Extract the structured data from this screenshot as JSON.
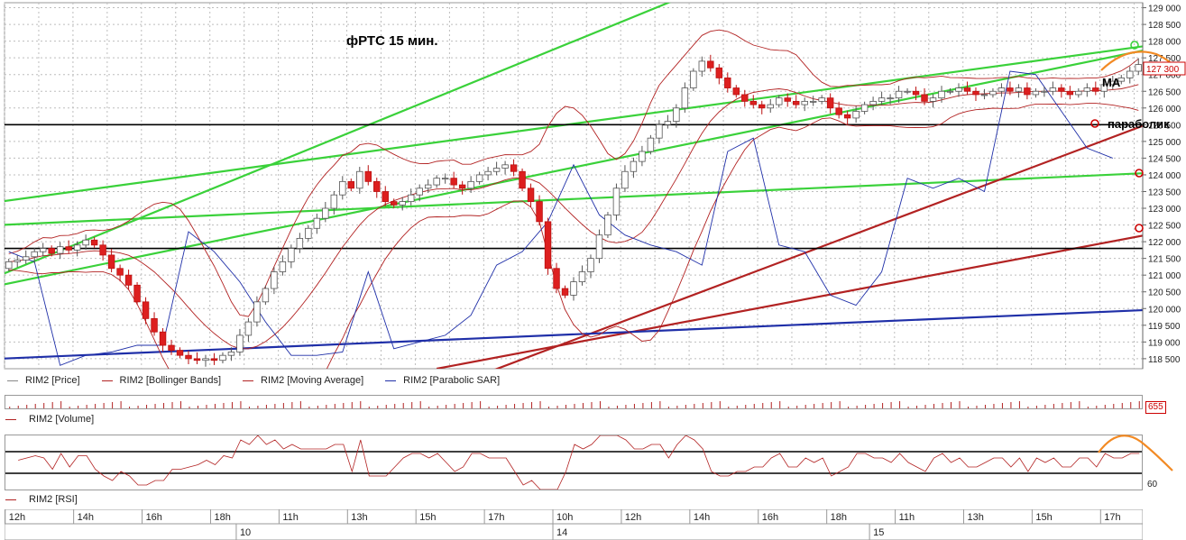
{
  "title": "фРТС   15 мин.",
  "annotations": {
    "ma": "MA",
    "parabolic": "параболик"
  },
  "legend": [
    {
      "label": "RIM2 [Price]",
      "color": "#888888"
    },
    {
      "label": "RIM2 [Bollinger Bands]",
      "color": "#b22222"
    },
    {
      "label": "RIM2 [Moving Average]",
      "color": "#b22222"
    },
    {
      "label": "RIM2 [Parabolic SAR]",
      "color": "#1f2fa8"
    }
  ],
  "volume_label": "RIM2 [Volume]",
  "volume_tag": "655",
  "rsi_label": "RIM2 [RSI]",
  "rsi_tag": "60",
  "price_tag": "127 300",
  "colors": {
    "up_candle": "#ffffff",
    "down_candle": "#dd1f1f",
    "bollinger": "#b22222",
    "sar": "#1f2fa8",
    "trend_green": "#3ad13a",
    "trend_red": "#b22222",
    "trend_blue": "#1f2fa8",
    "forecast": "#f28a24"
  },
  "chart_data": {
    "type": "candlestick",
    "title": "фРТС   15 мин.",
    "y_ticks": [
      "118 500",
      "119 000",
      "119 500",
      "120 000",
      "120 500",
      "121 000",
      "121 500",
      "122 000",
      "122 500",
      "123 000",
      "123 500",
      "124 000",
      "124 500",
      "125 000",
      "125 500",
      "126 000",
      "126 500",
      "127 000",
      "127 500",
      "128 000",
      "128 500",
      "129 000"
    ],
    "ylim": [
      118200,
      129150
    ],
    "x_ticks": [
      {
        "label": "12h",
        "index": 0
      },
      {
        "label": "14h",
        "index": 8
      },
      {
        "label": "16h",
        "index": 16
      },
      {
        "label": "18h",
        "index": 24
      },
      {
        "label": "11h",
        "index": 32
      },
      {
        "label": "13h",
        "index": 40
      },
      {
        "label": "15h",
        "index": 48
      },
      {
        "label": "17h",
        "index": 56
      },
      {
        "label": "10h",
        "index": 64
      },
      {
        "label": "12h",
        "index": 72
      },
      {
        "label": "14h",
        "index": 80
      },
      {
        "label": "16h",
        "index": 88
      },
      {
        "label": "18h",
        "index": 96
      },
      {
        "label": "11h",
        "index": 104
      },
      {
        "label": "13h",
        "index": 112
      },
      {
        "label": "15h",
        "index": 120
      },
      {
        "label": "17h",
        "index": 128
      }
    ],
    "date_labels": [
      {
        "label": "10",
        "index": 27
      },
      {
        "label": "14",
        "index": 64
      },
      {
        "label": "15",
        "index": 101
      }
    ],
    "closes": [
      121400,
      121450,
      121550,
      121700,
      121800,
      121650,
      121850,
      121750,
      121900,
      122050,
      121900,
      121600,
      121200,
      121000,
      120700,
      120200,
      119700,
      119300,
      118900,
      118750,
      118600,
      118500,
      118450,
      118500,
      118450,
      118600,
      118700,
      119200,
      119600,
      120200,
      120600,
      121100,
      121400,
      121800,
      122100,
      122400,
      122700,
      123000,
      123400,
      123800,
      123600,
      124100,
      123800,
      123500,
      123200,
      123100,
      123200,
      123400,
      123600,
      123700,
      123900,
      123900,
      123700,
      123600,
      123800,
      124000,
      124100,
      124200,
      124300,
      124100,
      123600,
      123200,
      122600,
      121200,
      120600,
      120400,
      120800,
      121100,
      121500,
      122200,
      122800,
      123600,
      124100,
      124400,
      124700,
      125100,
      125500,
      125600,
      126000,
      126600,
      127100,
      127400,
      127200,
      126900,
      126600,
      126400,
      126200,
      126100,
      126000,
      126100,
      126300,
      126200,
      126100,
      126200,
      126200,
      126300,
      126000,
      125800,
      125700,
      125900,
      126100,
      126200,
      126300,
      126300,
      126500,
      126500,
      126400,
      126200,
      126300,
      126500,
      126500,
      126600,
      126500,
      126400,
      126400,
      126500,
      126600,
      126500,
      126600,
      126400,
      126500,
      126500,
      126600,
      126500,
      126400,
      126500,
      126600,
      126500,
      126700,
      126800,
      126900,
      127100,
      127300
    ],
    "parabolic_sar": [
      121700,
      121400,
      118300,
      118600,
      118700,
      118900,
      118900,
      122300,
      121700,
      120800,
      119600,
      118600,
      118600,
      118700,
      121100,
      118800,
      119000,
      119200,
      119800,
      121300,
      121700,
      122600,
      124300,
      122800,
      122200,
      121900,
      121700,
      121300,
      124700,
      125100,
      121900,
      121700,
      120400,
      120100,
      121100,
      123900,
      123600,
      123900,
      123500,
      127100,
      127000,
      125900,
      124800,
      124500
    ],
    "sar_step": 3,
    "trendlines": [
      {
        "color": "green",
        "points": [
          [
            -1,
            123200
          ],
          [
            137,
            128000
          ]
        ]
      },
      {
        "color": "green",
        "points": [
          [
            -1,
            122500
          ],
          [
            137,
            124100
          ]
        ]
      },
      {
        "color": "green",
        "points": [
          [
            -1,
            120700
          ],
          [
            135,
            127850
          ]
        ]
      },
      {
        "color": "green",
        "points": [
          [
            -1,
            121000
          ],
          [
            90,
            130500
          ]
        ]
      },
      {
        "color": "red",
        "points": [
          [
            55,
            118000
          ],
          [
            137,
            125900
          ]
        ]
      },
      {
        "color": "red",
        "points": [
          [
            50,
            118200
          ],
          [
            137,
            122400
          ]
        ]
      },
      {
        "color": "blue",
        "points": [
          [
            -1,
            118500
          ],
          [
            137,
            120000
          ]
        ]
      },
      {
        "color": "black",
        "points": [
          [
            -1,
            125500
          ],
          [
            137,
            125500
          ]
        ]
      },
      {
        "color": "black",
        "points": [
          [
            -1,
            121800
          ],
          [
            137,
            121800
          ]
        ]
      }
    ],
    "rsi_levels": [
      70,
      30
    ]
  }
}
